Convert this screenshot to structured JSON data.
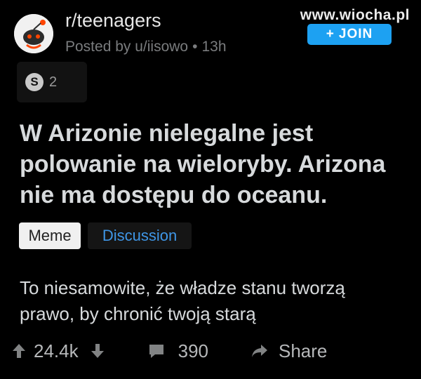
{
  "header": {
    "subreddit": "r/teenagers",
    "posted_by": "Posted by u/iisowo",
    "time": "13h",
    "join_label": "JOIN",
    "watermark": "www.wiocha.pl"
  },
  "award": {
    "count": "2"
  },
  "post": {
    "title": "W Arizonie nielegalne jest polowanie na wieloryby. Arizona nie ma dostępu do oceanu.",
    "flairs": [
      "Meme",
      "Discussion"
    ],
    "body": "To niesamowite, że władze stanu tworzą prawo, by chronić twoją starą"
  },
  "actions": {
    "score": "24.4k",
    "comments": "390",
    "share_label": "Share"
  },
  "colors": {
    "background": "#000000",
    "join_button": "#1da1f2",
    "discussion_flair_text": "#3f96e6",
    "meme_flair_bg": "#f0f0f0"
  },
  "icons": [
    "reddit-snoo-avatar",
    "plus-icon",
    "award-icon",
    "upvote-arrow",
    "downvote-arrow",
    "comment-icon",
    "share-arrow-icon"
  ]
}
